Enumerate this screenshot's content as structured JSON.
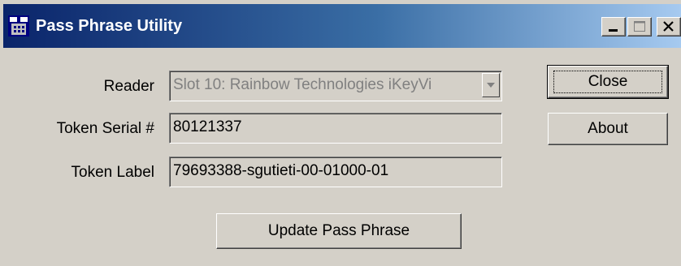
{
  "window": {
    "title": "Pass Phrase Utility",
    "icon": "pass-phrase-app-icon"
  },
  "caption_buttons": {
    "minimize_icon": "minimize-icon",
    "maximize_icon": "maximize-icon",
    "close_icon": "close-icon"
  },
  "form": {
    "reader_label": "Reader",
    "reader_value": "Slot 10: Rainbow Technologies iKeyVi",
    "token_serial_label": "Token Serial #",
    "token_serial_value": "80121337",
    "token_label_label": "Token Label",
    "token_label_value": "79693388-sgutieti-00-01000-01"
  },
  "buttons": {
    "close_label": "Close",
    "about_label": "About",
    "update_label": "Update Pass Phrase"
  },
  "colors": {
    "titlebar_start": "#0a246a",
    "titlebar_end": "#a6caf0",
    "face": "#d4d0c8"
  }
}
